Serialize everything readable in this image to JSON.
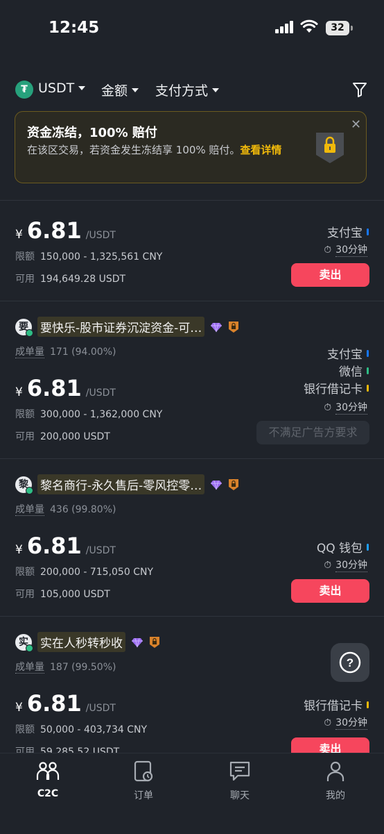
{
  "status_bar": {
    "time": "12:45",
    "battery": "32"
  },
  "filters": {
    "coin": "USDT",
    "amount": "金额",
    "payment": "支付方式",
    "coin_icon_glyph": "₮"
  },
  "banner": {
    "title": "资金冻结，100% 赔付",
    "text": "在该区交易，若资金发生冻结享 100% 赔付。",
    "link": "查看详情"
  },
  "listings": [
    {
      "price_currency": "¥",
      "price": "6.81",
      "unit": "/USDT",
      "limit_label": "限额",
      "limit": "150,000 - 1,325,561 CNY",
      "available_label": "可用",
      "available": "194,649.28 USDT",
      "payments": [
        "支付宝"
      ],
      "time_limit": "30分钟",
      "action": "卖出"
    },
    {
      "avatar": "要",
      "merchant": "要快乐-股市证券沉淀资金-可…",
      "orders_label": "成单量",
      "orders": "171 (94.00%)",
      "price_currency": "¥",
      "price": "6.81",
      "unit": "/USDT",
      "limit_label": "限额",
      "limit": "300,000 - 1,362,000 CNY",
      "available_label": "可用",
      "available": "200,000 USDT",
      "payments": [
        "支付宝",
        "微信",
        "银行借记卡"
      ],
      "time_limit": "30分钟",
      "action": "不满足广告方要求"
    },
    {
      "avatar": "黎",
      "merchant": "黎名商行-永久售后-零风控零…",
      "orders_label": "成单量",
      "orders": "436 (99.80%)",
      "price_currency": "¥",
      "price": "6.81",
      "unit": "/USDT",
      "limit_label": "限额",
      "limit": "200,000 - 715,050 CNY",
      "available_label": "可用",
      "available": "105,000 USDT",
      "payments": [
        "QQ 钱包"
      ],
      "time_limit": "30分钟",
      "action": "卖出"
    },
    {
      "avatar": "实",
      "merchant": "实在人秒转秒收",
      "orders_label": "成单量",
      "orders": "187 (99.50%)",
      "price_currency": "¥",
      "price": "6.81",
      "unit": "/USDT",
      "limit_label": "限额",
      "limit": "50,000 - 403,734 CNY",
      "available_label": "可用",
      "available": "59,285.52 USDT",
      "payments": [
        "银行借记卡"
      ],
      "time_limit": "30分钟",
      "action": "卖出"
    }
  ],
  "help_glyph": "?",
  "tabs": [
    {
      "label": "C2C",
      "icon": "users-icon",
      "active": true
    },
    {
      "label": "订单",
      "icon": "order-icon",
      "active": false
    },
    {
      "label": "聊天",
      "icon": "chat-icon",
      "active": false
    },
    {
      "label": "我的",
      "icon": "profile-icon",
      "active": false
    }
  ],
  "colors": {
    "background": "#1f232a",
    "sell": "#f6465d",
    "accent_gold": "#f0b90b",
    "online": "#2ebd85",
    "usdt": "#27a17c",
    "alipay": "#1677ff",
    "wechat": "#2ebd85",
    "bank": "#f0b90b",
    "qq": "#1e9fff"
  }
}
